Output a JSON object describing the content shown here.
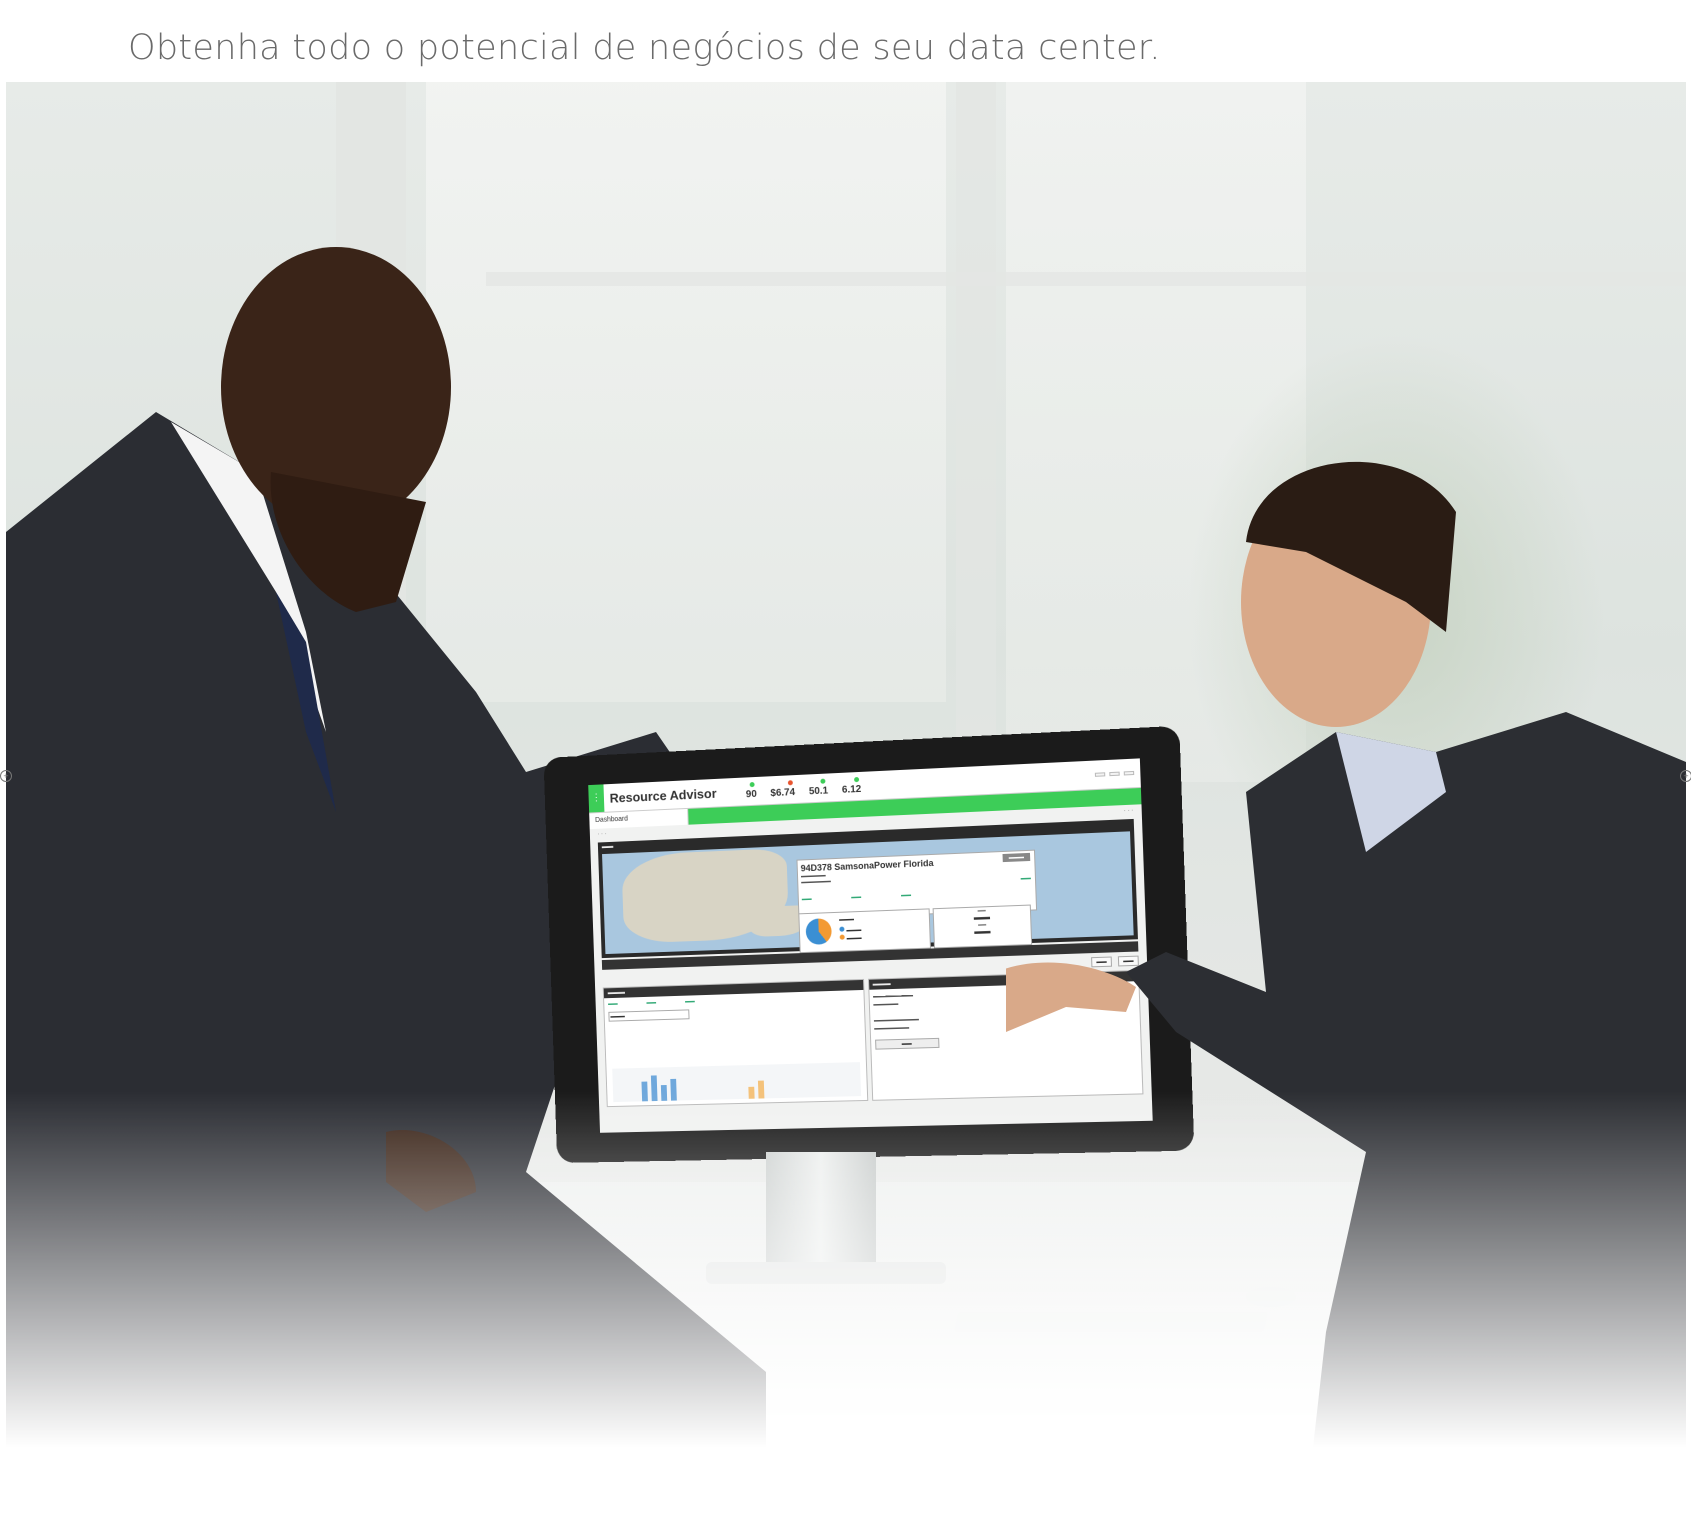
{
  "page": {
    "title_partial": "",
    "subtitle": "Obtenha todo o potencial de negócios de seu data center."
  },
  "app": {
    "name": "Resource Advisor",
    "kpis": [
      {
        "label": "",
        "value": "90",
        "color": "#3dcd58"
      },
      {
        "label": "",
        "value": "$6.74",
        "color": "#e8542f"
      },
      {
        "label": "",
        "value": "50.1",
        "color": "#3dcd58"
      },
      {
        "label": "",
        "value": "6.12",
        "color": "#3dcd58"
      }
    ],
    "header_buttons": [
      "",
      "",
      ""
    ],
    "nav": [
      "Dashboard",
      "",
      "",
      "",
      ""
    ],
    "site": {
      "name": "94D378 SamsonaPower Florida"
    },
    "colors": {
      "accent": "#3dcd58",
      "pie_a": "#f39a33",
      "pie_b": "#3b8fd3"
    }
  }
}
